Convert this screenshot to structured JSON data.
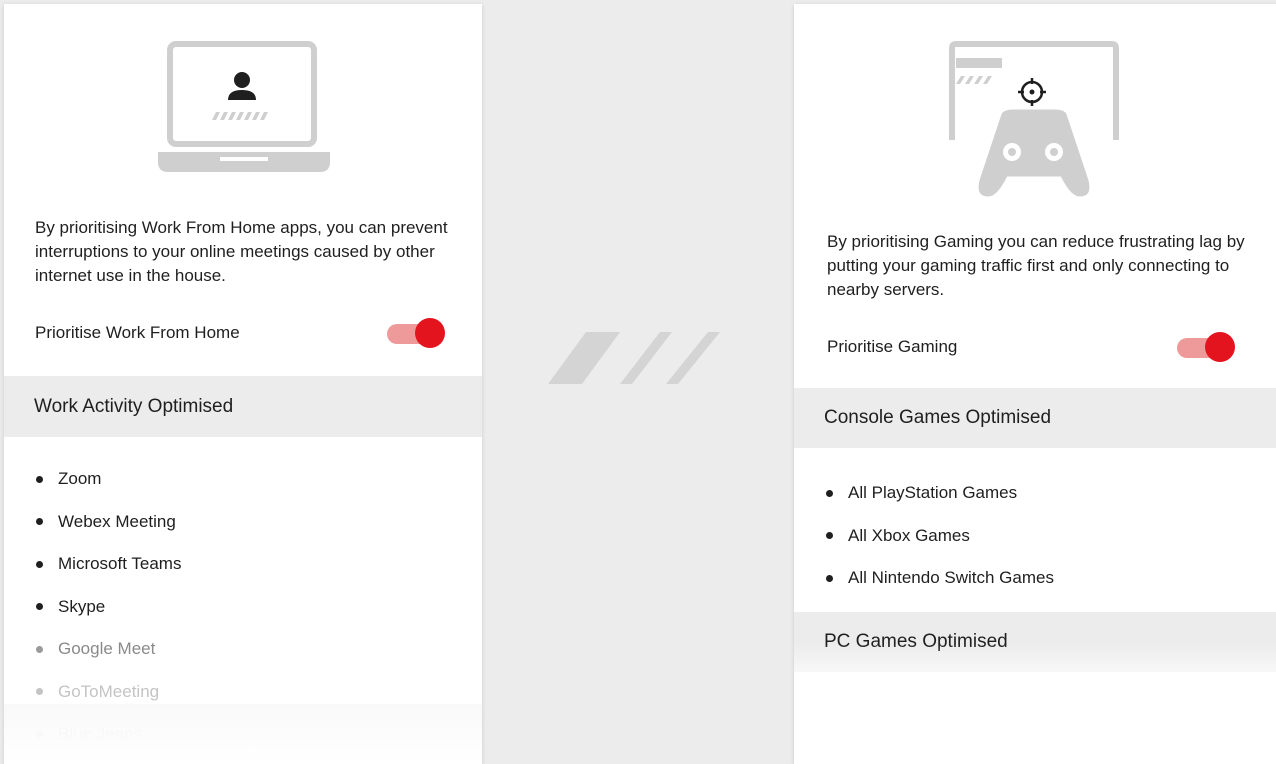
{
  "colors": {
    "accent": "#e3141e",
    "accent_light": "#ef9a9a",
    "panel_bg": "#ececec",
    "card_bg": "#ffffff",
    "illustration_gray": "#cfcfcf"
  },
  "wfh": {
    "illustration_icon": "laptop-with-person-icon",
    "description": "By prioritising Work From Home apps, you can prevent interruptions to your online meetings caused by other internet use in the house.",
    "toggle_label": "Prioritise Work From Home",
    "toggle_on": true,
    "section_title": "Work Activity Optimised",
    "apps": [
      "Zoom",
      "Webex Meeting",
      "Microsoft Teams",
      "Skype",
      "Google Meet",
      "GoToMeeting",
      "Blue Jeans"
    ]
  },
  "gaming": {
    "illustration_icon": "gamepad-with-crosshair-icon",
    "description": "By prioritising Gaming you can reduce frustrating lag by putting your gaming traffic first and only connecting to nearby servers.",
    "toggle_label": "Prioritise Gaming",
    "toggle_on": true,
    "console_section_title": "Console Games Optimised",
    "console_games": [
      "All PlayStation Games",
      "All Xbox Games",
      "All Nintendo Switch Games"
    ],
    "pc_section_title": "PC Games Optimised"
  },
  "divider_icon": "slashes-graphic"
}
